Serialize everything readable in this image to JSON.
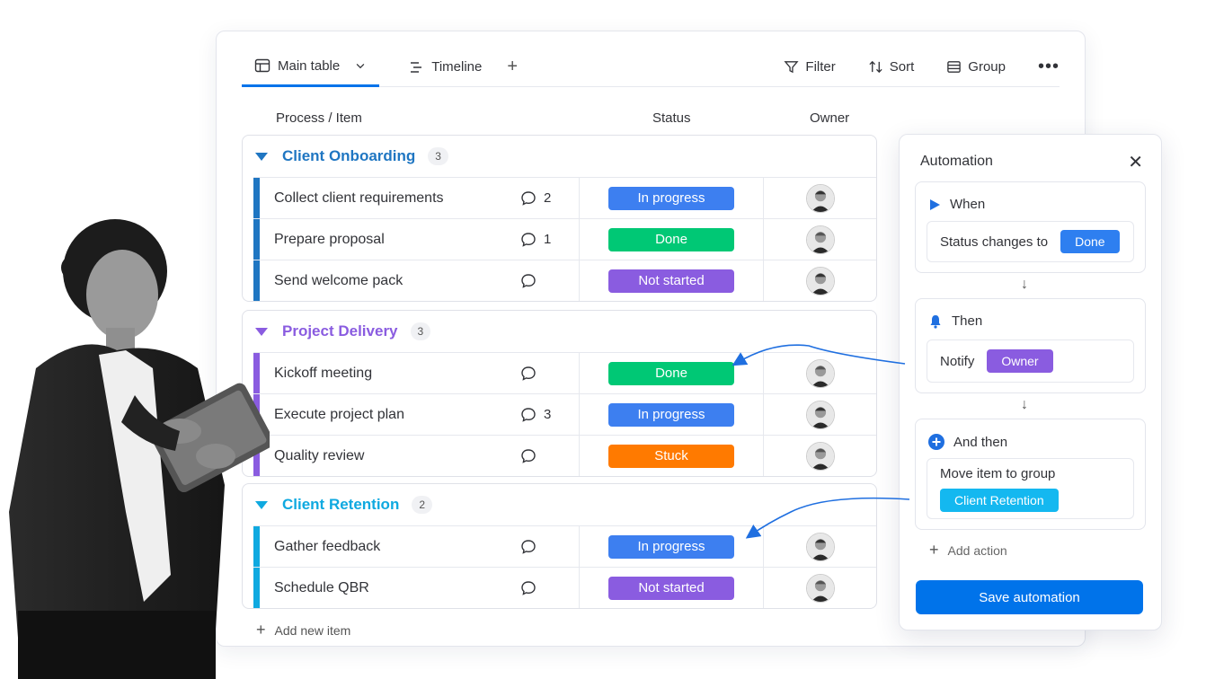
{
  "tabs": {
    "main_table": "Main table",
    "timeline": "Timeline",
    "add": "+"
  },
  "tools": {
    "filter": "Filter",
    "sort": "Sort",
    "group": "Group",
    "more": "•••"
  },
  "columns": {
    "item": "Process / Item",
    "status": "Status",
    "owner": "Owner"
  },
  "groups": [
    {
      "title": "Client Onboarding",
      "count": "3",
      "color": "#1f76c2",
      "items": [
        {
          "name": "Collect client requirements",
          "comments": "2",
          "status": "In progress",
          "status_color": "#3d7ff0"
        },
        {
          "name": "Prepare proposal",
          "comments": "1",
          "status": "Done",
          "status_color": "#00c875"
        },
        {
          "name": "Send welcome pack",
          "comments": "",
          "status": "Not started",
          "status_color": "#8a5ce0"
        }
      ]
    },
    {
      "title": "Project Delivery",
      "count": "3",
      "color": "#8a5ce0",
      "items": [
        {
          "name": "Kickoff meeting",
          "comments": "",
          "status": "Done",
          "status_color": "#00c875"
        },
        {
          "name": "Execute project plan",
          "comments": "3",
          "status": "In progress",
          "status_color": "#3d7ff0"
        },
        {
          "name": "Quality review",
          "comments": "",
          "status": "Stuck",
          "status_color": "#ff7a00"
        }
      ]
    },
    {
      "title": "Client Retention",
      "count": "2",
      "color": "#0fa9e0",
      "items": [
        {
          "name": "Gather feedback",
          "comments": "",
          "status": "In progress",
          "status_color": "#3d7ff0"
        },
        {
          "name": "Schedule QBR",
          "comments": "",
          "status": "Not started",
          "status_color": "#8a5ce0"
        }
      ]
    }
  ],
  "add_item": "Add new item",
  "automation": {
    "title": "Automation",
    "when_label": "When",
    "when_condition": "Status changes to",
    "when_value": "Done",
    "then_label": "Then",
    "then_action": "Notify",
    "then_value": "Owner",
    "and_then_label": "And then",
    "and_then_action": "Move item to group",
    "and_then_value": "Client Retention",
    "add_action": "Add action",
    "save": "Save automation"
  }
}
